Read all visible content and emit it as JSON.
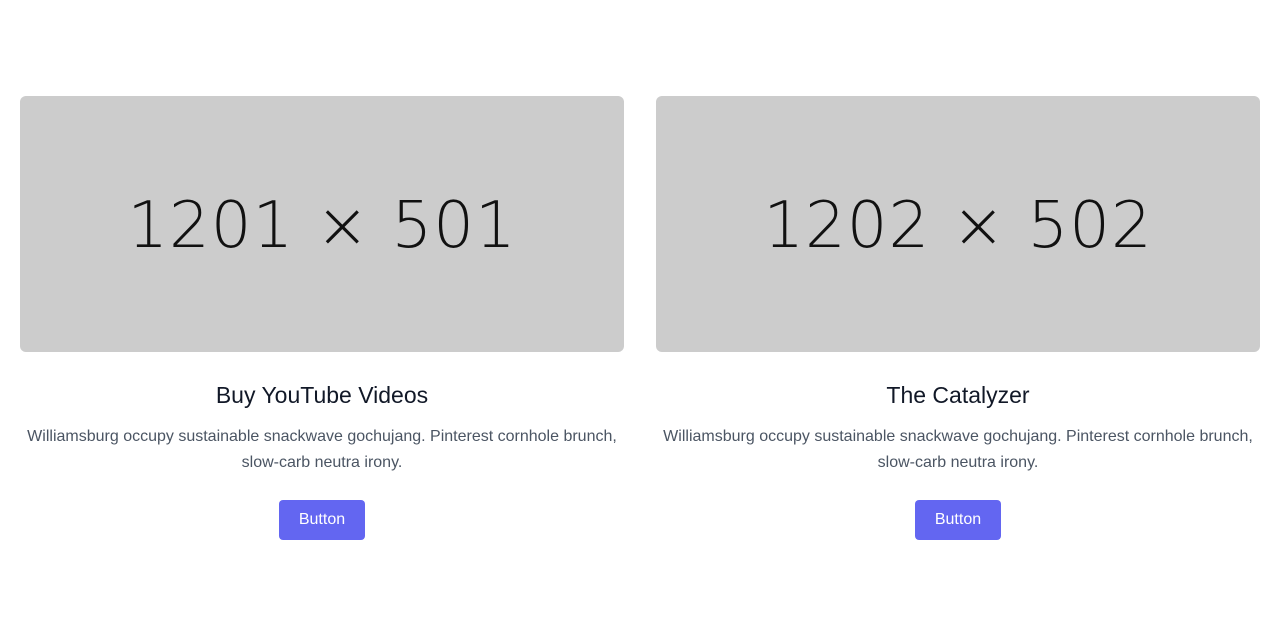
{
  "cards": [
    {
      "image_text": "1201 × 501",
      "title": "Buy YouTube Videos",
      "description": "Williamsburg occupy sustainable snackwave gochujang. Pinterest cornhole brunch, slow-carb neutra irony.",
      "button_label": "Button"
    },
    {
      "image_text": "1202 × 502",
      "title": "The Catalyzer",
      "description": "Williamsburg occupy sustainable snackwave gochujang. Pinterest cornhole brunch, slow-carb neutra irony.",
      "button_label": "Button"
    }
  ],
  "colors": {
    "accent": "#6366f1",
    "placeholder_bg": "#cccccc",
    "title": "#111827",
    "body_text": "#4b5563"
  }
}
